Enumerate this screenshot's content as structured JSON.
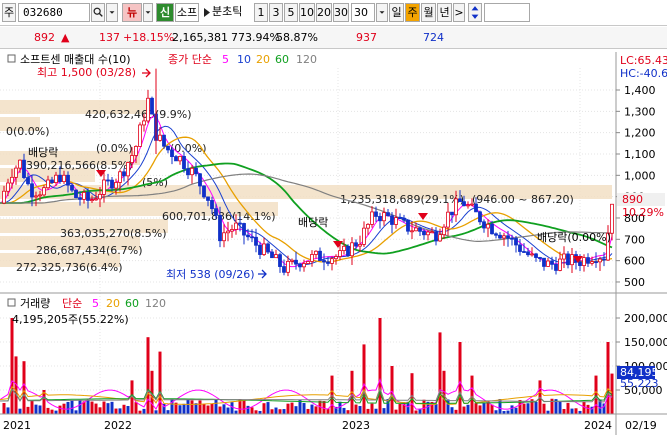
{
  "toolbar": {
    "market_label": "주",
    "stock_code": "032680",
    "news_label": "뉴",
    "credit_label": "신",
    "company_name": "소프",
    "minute_label": "분초틱",
    "intervals": [
      "1",
      "3",
      "5",
      "10",
      "20",
      "30"
    ],
    "period_input": "30",
    "periods": [
      "일",
      "주",
      "월",
      "년"
    ],
    "active_period": "주",
    "more_label": ">"
  },
  "quote": {
    "price": "892",
    "change": "137",
    "change_pct": "+18.15%",
    "volume": "2,165,381",
    "volume_ratio": "773.94%",
    "turnover": "58.87%",
    "val_a": "937",
    "val_b": "724"
  },
  "price_panel": {
    "title": "소프트센 매출대 수(10)",
    "ma_label": "종가 단순",
    "ma_periods": [
      "5",
      "10",
      "20",
      "60",
      "120"
    ],
    "lc": "LC:65.43",
    "hc": "HC:-40.6",
    "high_note": "최고 1,500 (03/28)",
    "low_note": "최저 538 (09/26)",
    "dividend_drop": "배당락",
    "dividend_note_3": "배당락(0.00%)",
    "price_tag": "890",
    "pct_tag": "10.29%",
    "volume_profile_labels": [
      "420,632,463(9.9%)",
      "0(0.0%)",
      "390,216,566(8.5%)",
      "(0.0%)",
      "(5%)",
      "(0.0%)",
      "600,701,836(14.1%)",
      "363,035,270(8.5%)",
      "286,687,434(6.7%)",
      "272,325,736(6.4%)",
      "1,235,318,689(29.1%)",
      "(946.00 ~ 867.20)"
    ],
    "y_ticks": [
      "1,400",
      "1,300",
      "1,200",
      "1,100",
      "1,000",
      "900",
      "800",
      "700",
      "600",
      "500"
    ]
  },
  "volume_panel": {
    "title": "거래량",
    "ma_label": "단순",
    "ma_periods": [
      "5",
      "20",
      "60",
      "120"
    ],
    "max_note": "4,195,205주(55.22%)",
    "y_ticks": [
      "200,000",
      "150,000",
      "100,000",
      "50,000"
    ],
    "tag_last": "84,195",
    "tag_ma": "55,223"
  },
  "x_axis": {
    "labels": [
      "2021",
      "2022",
      "2023",
      "2024"
    ],
    "last_date": "02/19"
  },
  "colors": {
    "up": "#e0001a",
    "down": "#1030c8",
    "ma5": "#ff00ff",
    "ma10": "#1a40d0",
    "ma20": "#e8a000",
    "ma60": "#10a020",
    "ma120": "#808080"
  }
}
